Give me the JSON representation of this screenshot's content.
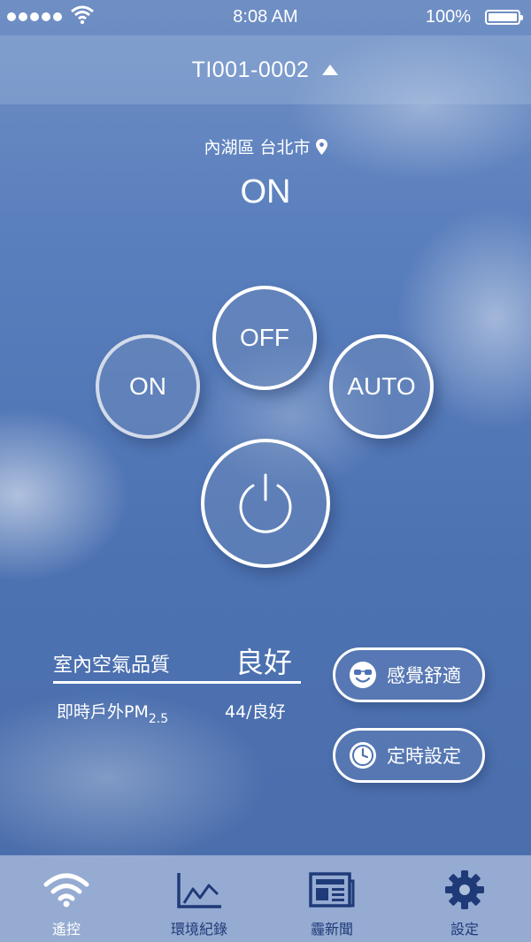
{
  "status_bar": {
    "time": "8:08 AM",
    "battery": "100%"
  },
  "device": {
    "name": "TI001-0002"
  },
  "location": {
    "text": "內湖區 台北市"
  },
  "state": "ON",
  "controls": {
    "on_label": "ON",
    "off_label": "OFF",
    "auto_label": "AUTO"
  },
  "air_quality": {
    "indoor_label": "室內空氣品質",
    "indoor_value": "良好",
    "outdoor_label": "即時戶外PM",
    "outdoor_sub": "2.5",
    "outdoor_value": "44/良好"
  },
  "actions": {
    "comfort_label": "感覺舒適",
    "timer_label": "定時設定"
  },
  "tabs": [
    {
      "label": "遙控",
      "icon": "wifi-icon",
      "active": true
    },
    {
      "label": "環境紀錄",
      "icon": "chart-icon",
      "active": false
    },
    {
      "label": "霾新聞",
      "icon": "news-icon",
      "active": false
    },
    {
      "label": "設定",
      "icon": "gear-icon",
      "active": false
    }
  ],
  "colors": {
    "tab_inactive": "#1f3a78",
    "tab_active": "#ffffff"
  }
}
